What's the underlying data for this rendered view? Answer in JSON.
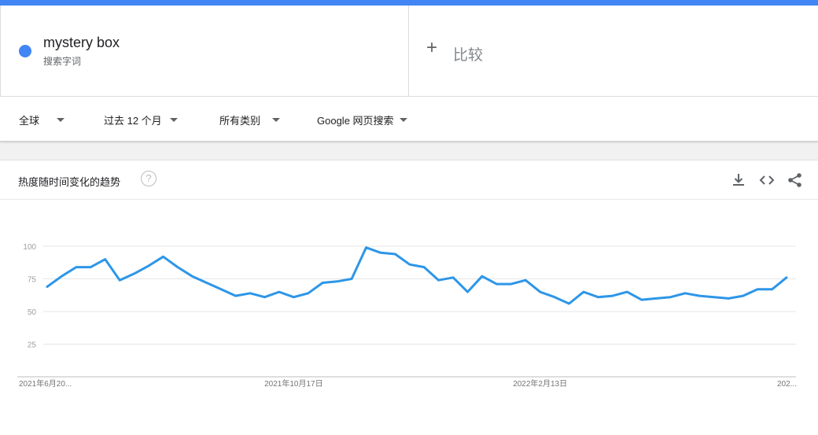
{
  "search": {
    "term": "mystery box",
    "term_type": "搜索字词",
    "term_color": "#4285f4",
    "compare_label": "比较"
  },
  "filters": [
    {
      "label": "全球"
    },
    {
      "label": "过去 12 个月"
    },
    {
      "label": "所有类别"
    },
    {
      "label": "Google 网页搜索"
    }
  ],
  "card": {
    "title": "热度随时间变化的趋势",
    "help": "?",
    "icons": [
      "download-icon",
      "embed-icon",
      "share-icon"
    ]
  },
  "chart_data": {
    "type": "line",
    "title": "",
    "xlabel": "",
    "ylabel": "",
    "ylim": [
      0,
      100
    ],
    "yticks": [
      25,
      50,
      75,
      100
    ],
    "grid": true,
    "x_tick_labels": [
      {
        "index": 0,
        "label": "2021年6月20..."
      },
      {
        "index": 17,
        "label": "2021年10月17日"
      },
      {
        "index": 34,
        "label": "2022年2月13日"
      },
      {
        "index": 52,
        "label": "202..."
      }
    ],
    "series": [
      {
        "color": "#2d96e8",
        "values": [
          69,
          77,
          84,
          84,
          90,
          74,
          79,
          85,
          92,
          84,
          77,
          72,
          67,
          62,
          64,
          61,
          65,
          61,
          64,
          72,
          73,
          75,
          99,
          95,
          94,
          86,
          84,
          74,
          76,
          65,
          77,
          71,
          71,
          74,
          65,
          61,
          56,
          65,
          61,
          62,
          65,
          59,
          60,
          61,
          64,
          62,
          61,
          60,
          62,
          67,
          67,
          76
        ]
      }
    ]
  }
}
